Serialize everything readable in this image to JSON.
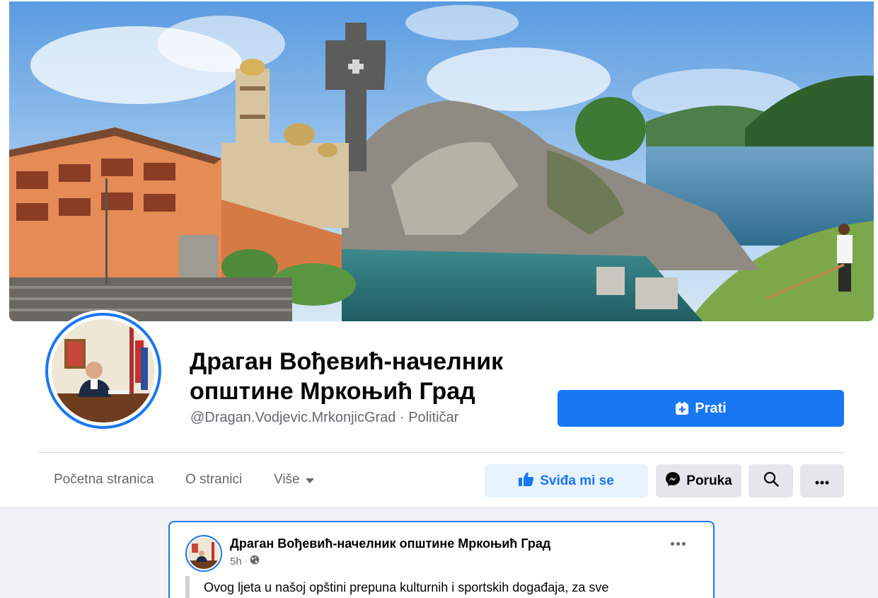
{
  "profile": {
    "name": "Драган Вођевић-начелник општине Мркоњић Град",
    "handle": "@Dragan.Vodjevic.MrkonjicGrad",
    "separator": " · ",
    "category": "Političar"
  },
  "follow_button": {
    "label": "Prati",
    "icon": "follow-plus-icon"
  },
  "tabs": [
    {
      "label": "Početna stranica"
    },
    {
      "label": "O stranici"
    },
    {
      "label": "Više",
      "icon": "caret-down-icon"
    }
  ],
  "actions": {
    "like_label": "Sviđa mi se",
    "message_label": "Poruka",
    "search_icon": "search-icon",
    "more_icon": "more-dots-icon"
  },
  "post": {
    "author": "Драган Вођевић-начелник општине Мркоњић Град",
    "time": "5h",
    "privacy_icon": "globe-icon",
    "text": "Ovog ljeta u našoj opštini prepuna kulturnih i sportskih događaja, za sve"
  },
  "colors": {
    "accent": "#1877f2",
    "like_bg": "#e7f3ff",
    "button_grey": "#e4e6eb",
    "page_bg": "#f0f2f5",
    "secondary_text": "#65676b"
  }
}
